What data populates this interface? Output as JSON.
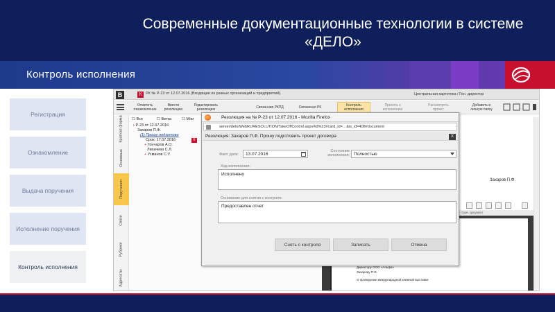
{
  "slide": {
    "title": "Современные документационные технологии в системе «ДЕЛО»",
    "section": "Контроль исполнения",
    "header_bg": "#0e1f5c",
    "accent": "#c8102e"
  },
  "steps": [
    {
      "label": "Регистрация",
      "active": false
    },
    {
      "label": "Ознакомление",
      "active": false
    },
    {
      "label": "Выдача поручения",
      "active": false
    },
    {
      "label": "Исполнение поручения",
      "active": false
    },
    {
      "label": "Контроль исполнения",
      "active": true
    }
  ],
  "app": {
    "logo_letter": "B",
    "k_letter": "К",
    "title": "РК № Р-23 от 12.07.2016 (Входящие из разных организаций и предприятий)",
    "right_title": "Центральная картотека / Ген. директор",
    "toolbar": [
      {
        "label": "Отметить ознакомление",
        "highlight": false
      },
      {
        "label": "Ввести резолюцию",
        "highlight": false
      },
      {
        "label": "Редактировать резолюцию",
        "highlight": false
      },
      {
        "label": "Связанная РКПД",
        "highlight": false
      },
      {
        "label": "Связанная РК",
        "highlight": false
      },
      {
        "label": "Контроль исполнения",
        "highlight": true
      },
      {
        "label": "Принять к исполнению",
        "highlight": false
      },
      {
        "label": "Рассмотреть проект",
        "highlight": false
      },
      {
        "label": "Добавить в личную папку",
        "highlight": false
      }
    ],
    "vtabs": [
      {
        "label": "Краткая форма",
        "active": false
      },
      {
        "label": "Основные",
        "active": false
      },
      {
        "label": "Поручения",
        "active": true
      },
      {
        "label": "Связи",
        "active": false
      },
      {
        "label": "Рубрики",
        "active": false
      },
      {
        "label": "Адресаты",
        "active": false
      }
    ],
    "tree": {
      "filters": [
        "Все",
        "Ветка",
        "Мои"
      ],
      "lines": [
        {
          "text": "Р-23 от 12.07.2016",
          "cls": ""
        },
        {
          "text": "Захаров П.Ф.",
          "cls": ""
        },
        {
          "text": "(1) Прошу подготови",
          "cls": "blue"
        },
        {
          "text": "Срок: 17.07.2016",
          "cls": ""
        },
        {
          "text": "Гончаров А.О.",
          "cls": ""
        },
        {
          "text": "Лихачева С.Л.",
          "cls": ""
        },
        {
          "text": "Усманов С.У.",
          "cls": ""
        }
      ]
    },
    "right_doc_name": "Захаров П.Ф.",
    "pdf_tab": "Ориг. документ",
    "pdf_lines": [
      "Директору  ООО «Альфа»",
      "Захарову П.Ф.",
      "О проведении международной  книжной выставки"
    ]
  },
  "firefox": {
    "title": "Резолюция на № Р-23 от 12.07.2016 - Mozilla Firefox",
    "url": "server/delo/WebRc/RESOLUTION/TakeOffControl.aspx#id%23#card_id=…&is_id=408#document"
  },
  "dialog": {
    "title": "Резолюция: Захаров П.Ф. Прошу подготовить проект договора",
    "close": "X",
    "fact_date_label": "Факт. дата:",
    "fact_date": "13.07.2016",
    "state_label": "Состояние исполнения:",
    "state_value": "Полностью",
    "progress_label": "Ход исполнения:",
    "progress_value": "Исполнено",
    "basis_label": "Основание для снятия с контроля:",
    "basis_value": "Предоставлен отчет",
    "buttons": {
      "remove": "Снять с контроля",
      "save": "Записать",
      "cancel": "Отмена"
    }
  }
}
